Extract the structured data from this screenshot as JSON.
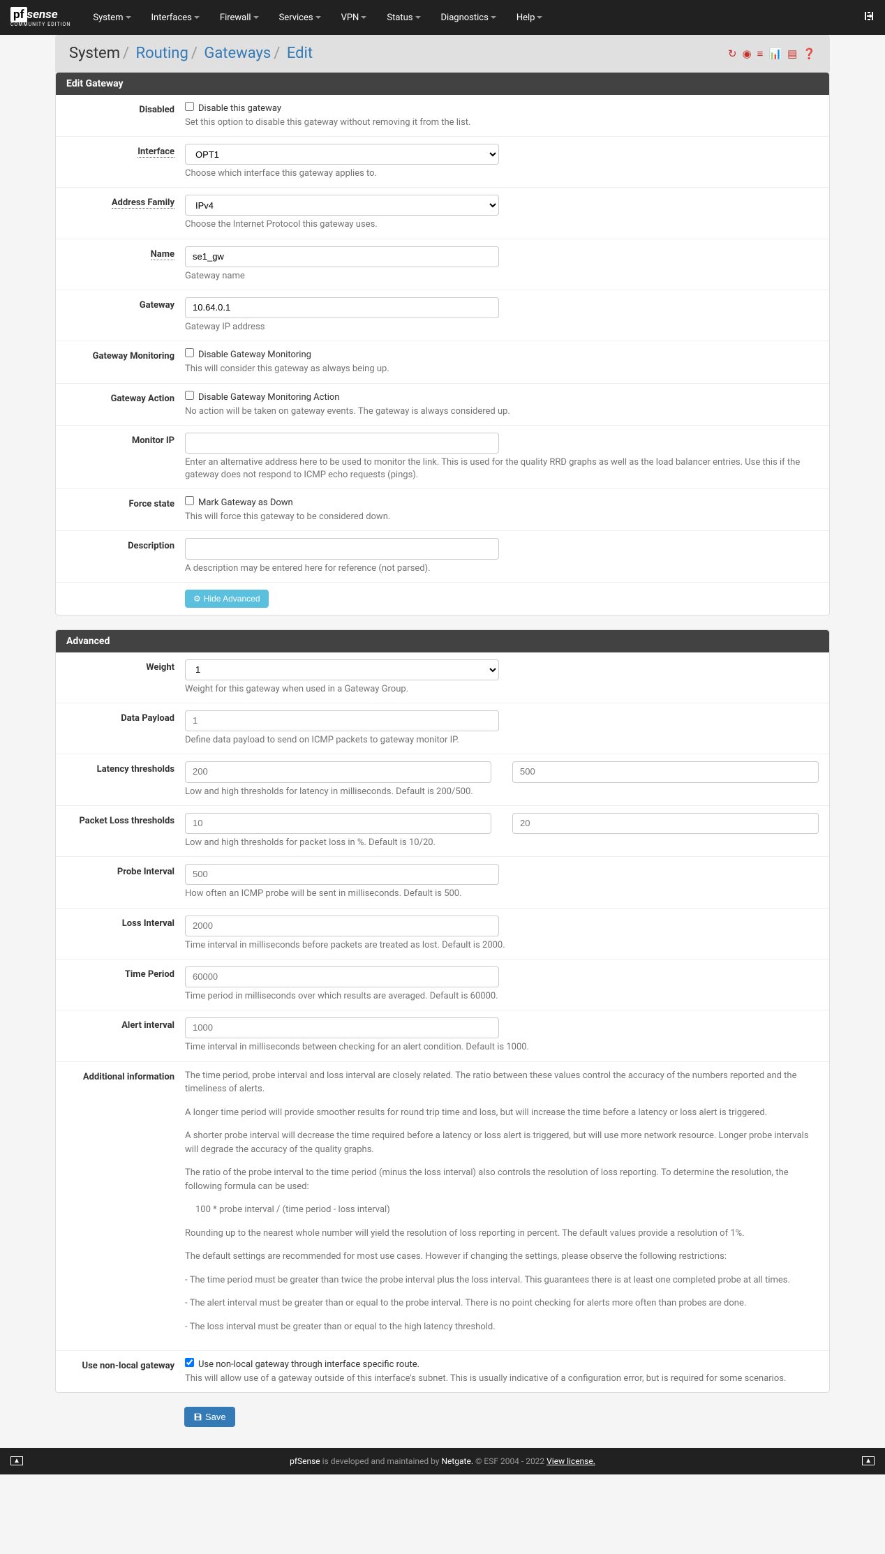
{
  "nav": {
    "items": [
      "System",
      "Interfaces",
      "Firewall",
      "Services",
      "VPN",
      "Status",
      "Diagnostics",
      "Help"
    ]
  },
  "logo": {
    "pf": "pf",
    "sense": "sense",
    "edition": "COMMUNITY EDITION"
  },
  "breadcrumb": {
    "system": "System",
    "routing": "Routing",
    "gateways": "Gateways",
    "edit": "Edit"
  },
  "panel1": {
    "title": "Edit Gateway",
    "disabled": {
      "label": "Disabled",
      "checkbox": "Disable this gateway",
      "help": "Set this option to disable this gateway without removing it from the list."
    },
    "interface": {
      "label": "Interface",
      "value": "OPT1",
      "help": "Choose which interface this gateway applies to."
    },
    "addrfam": {
      "label": "Address Family",
      "value": "IPv4",
      "help": "Choose the Internet Protocol this gateway uses."
    },
    "name": {
      "label": "Name",
      "value": "se1_gw",
      "help": "Gateway name"
    },
    "gateway": {
      "label": "Gateway",
      "value": "10.64.0.1",
      "help": "Gateway IP address"
    },
    "monitoring": {
      "label": "Gateway Monitoring",
      "checkbox": "Disable Gateway Monitoring",
      "help": "This will consider this gateway as always being up."
    },
    "action": {
      "label": "Gateway Action",
      "checkbox": "Disable Gateway Monitoring Action",
      "help": "No action will be taken on gateway events. The gateway is always considered up."
    },
    "monitorip": {
      "label": "Monitor IP",
      "help": "Enter an alternative address here to be used to monitor the link. This is used for the quality RRD graphs as well as the load balancer entries. Use this if the gateway does not respond to ICMP echo requests (pings)."
    },
    "force": {
      "label": "Force state",
      "checkbox": "Mark Gateway as Down",
      "help": "This will force this gateway to be considered down."
    },
    "desc": {
      "label": "Description",
      "help": "A description may be entered here for reference (not parsed)."
    },
    "hidebtn": "Hide Advanced"
  },
  "panel2": {
    "title": "Advanced",
    "weight": {
      "label": "Weight",
      "value": "1",
      "help": "Weight for this gateway when used in a Gateway Group."
    },
    "payload": {
      "label": "Data Payload",
      "placeholder": "1",
      "help": "Define data payload to send on ICMP packets to gateway monitor IP."
    },
    "latency": {
      "label": "Latency thresholds",
      "low": "200",
      "high": "500",
      "help": "Low and high thresholds for latency in milliseconds. Default is 200/500."
    },
    "loss": {
      "label": "Packet Loss thresholds",
      "low": "10",
      "high": "20",
      "help": "Low and high thresholds for packet loss in %. Default is 10/20."
    },
    "probe": {
      "label": "Probe Interval",
      "placeholder": "500",
      "help": "How often an ICMP probe will be sent in milliseconds. Default is 500."
    },
    "lossint": {
      "label": "Loss Interval",
      "placeholder": "2000",
      "help": "Time interval in milliseconds before packets are treated as lost. Default is 2000."
    },
    "period": {
      "label": "Time Period",
      "placeholder": "60000",
      "help": "Time period in milliseconds over which results are averaged. Default is 60000."
    },
    "alert": {
      "label": "Alert interval",
      "placeholder": "1000",
      "help": "Time interval in milliseconds between checking for an alert condition. Default is 1000."
    },
    "addinfo": {
      "label": "Additional information",
      "p1": "The time period, probe interval and loss interval are closely related. The ratio between these values control the accuracy of the numbers reported and the timeliness of alerts.",
      "p2": "A longer time period will provide smoother results for round trip time and loss, but will increase the time before a latency or loss alert is triggered.",
      "p3": "A shorter probe interval will decrease the time required before a latency or loss alert is triggered, but will use more network resource. Longer probe intervals will degrade the accuracy of the quality graphs.",
      "p4": "The ratio of the probe interval to the time period (minus the loss interval) also controls the resolution of loss reporting. To determine the resolution, the following formula can be used:",
      "p5": "100 * probe interval / (time period - loss interval)",
      "p6": "Rounding up to the nearest whole number will yield the resolution of loss reporting in percent. The default values provide a resolution of 1%.",
      "p7": "The default settings are recommended for most use cases. However if changing the settings, please observe the following restrictions:",
      "p8": "- The time period must be greater than twice the probe interval plus the loss interval. This guarantees there is at least one completed probe at all times.",
      "p9": "- The alert interval must be greater than or equal to the probe interval. There is no point checking for alerts more often than probes are done.",
      "p10": "- The loss interval must be greater than or equal to the high latency threshold."
    },
    "nonlocal": {
      "label": "Use non-local gateway",
      "checkbox": "Use non-local gateway through interface specific route.",
      "help": "This will allow use of a gateway outside of this interface's subnet. This is usually indicative of a configuration error, but is required for some scenarios."
    }
  },
  "save": "Save",
  "footer": {
    "pf": "pfSense",
    "dev": " is developed and maintained by ",
    "netgate": "Netgate.",
    "copy": " © ESF 2004 - 2022 ",
    "license": "View license."
  }
}
